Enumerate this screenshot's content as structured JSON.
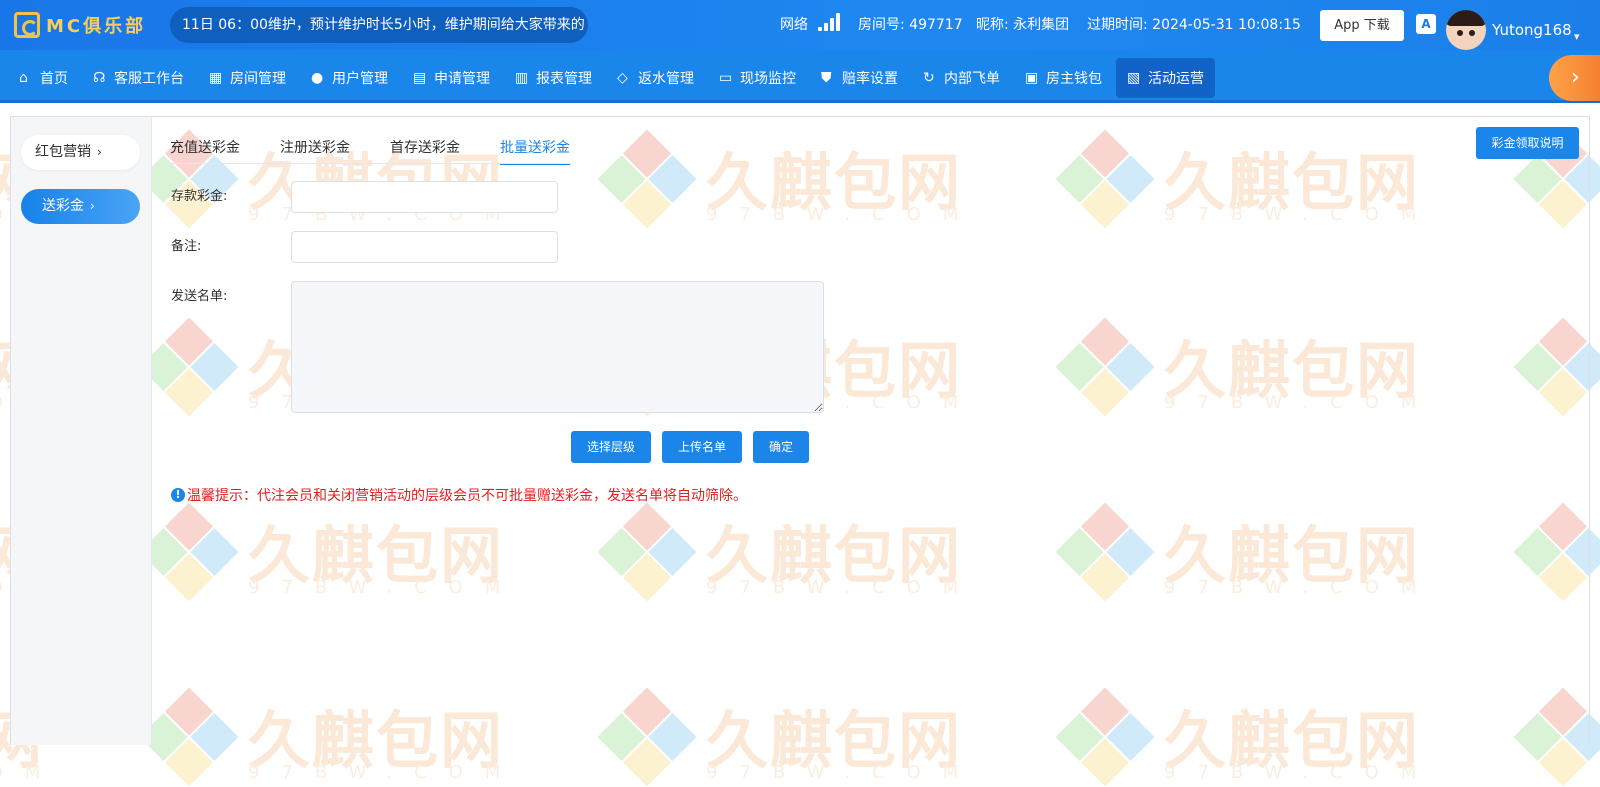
{
  "topbar": {
    "logo_text": "MC俱乐部",
    "marquee": "11日 06：00维护，预计维护时长5小时，维护期间给大家带来的",
    "network_label": "网络",
    "room_no": "房间号: 497717",
    "nickname": "昵称: 永利集团",
    "expire": "过期时间: 2024-05-31 10:08:15",
    "app_download": "App 下载",
    "lang_icon": "A",
    "username": "Yutong168",
    "caret": "▾"
  },
  "nav": {
    "items": [
      {
        "label": "首页",
        "icon": "home-icon"
      },
      {
        "label": "客服工作台",
        "icon": "headset-icon"
      },
      {
        "label": "房间管理",
        "icon": "grid-icon"
      },
      {
        "label": "用户管理",
        "icon": "user-icon"
      },
      {
        "label": "申请管理",
        "icon": "document-icon"
      },
      {
        "label": "报表管理",
        "icon": "bar-chart-icon"
      },
      {
        "label": "返水管理",
        "icon": "tag-icon"
      },
      {
        "label": "现场监控",
        "icon": "monitor-icon"
      },
      {
        "label": "赔率设置",
        "icon": "shield-icon"
      },
      {
        "label": "内部飞单",
        "icon": "refresh-icon"
      },
      {
        "label": "房主钱包",
        "icon": "wallet-icon"
      },
      {
        "label": "活动运营",
        "icon": "gift-icon",
        "active": true
      }
    ],
    "more_arrow": "›"
  },
  "sidebar": {
    "items": [
      {
        "label": "红包营销",
        "caret": "›"
      },
      {
        "label": "送彩金",
        "caret": "›",
        "active": true
      }
    ]
  },
  "tabs": [
    {
      "label": "充值送彩金"
    },
    {
      "label": "注册送彩金"
    },
    {
      "label": "首存送彩金"
    },
    {
      "label": "批量送彩金",
      "active": true
    }
  ],
  "explain_button": "彩金领取说明",
  "form": {
    "deposit_label": "存款彩金:",
    "deposit_value": "",
    "remark_label": "备注:",
    "remark_value": "",
    "list_label": "发送名单:",
    "list_value": ""
  },
  "buttons": {
    "select_level": "选择层级",
    "upload_list": "上传名单",
    "confirm": "确定"
  },
  "tip": {
    "icon": "!",
    "text": "温馨提示：代注会员和关闭营销活动的层级会员不可批量赠送彩金，发送名单将自动筛除。"
  },
  "watermark": {
    "text": "久麒包网",
    "sub": "97BW.COM"
  },
  "colors": {
    "primary": "#1a86ea",
    "nav_active": "#1263c7",
    "tip_red": "#e02020",
    "logo_gold": "#f5c344",
    "arrow_orange": "#f27b2a"
  }
}
